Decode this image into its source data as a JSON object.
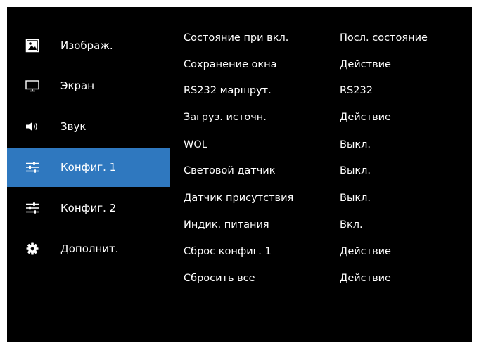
{
  "sidebar": {
    "items": [
      {
        "label": "Изображ.",
        "icon": "picture-icon",
        "active": false
      },
      {
        "label": "Экран",
        "icon": "monitor-icon",
        "active": false
      },
      {
        "label": "Звук",
        "icon": "speaker-icon",
        "active": false
      },
      {
        "label": "Конфиг. 1",
        "icon": "sliders-icon",
        "active": true
      },
      {
        "label": "Конфиг. 2",
        "icon": "sliders-icon",
        "active": false
      },
      {
        "label": "Дополнит.",
        "icon": "gear-icon",
        "active": false
      }
    ]
  },
  "settings": {
    "rows": [
      {
        "name": "Состояние при вкл.",
        "value": "Посл. состояние"
      },
      {
        "name": "Сохранение окна",
        "value": "Действие"
      },
      {
        "name": "RS232 маршрут.",
        "value": "RS232"
      },
      {
        "name": "Загруз. источн.",
        "value": "Действие"
      },
      {
        "name": "WOL",
        "value": "Выкл."
      },
      {
        "name": "Световой датчик",
        "value": "Выкл."
      },
      {
        "name": "Датчик присутствия",
        "value": "Выкл."
      },
      {
        "name": "Индик. питания",
        "value": "Вкл."
      },
      {
        "name": "Сброс конфиг. 1",
        "value": "Действие"
      },
      {
        "name": "Сбросить все",
        "value": "Действие"
      }
    ]
  },
  "colors": {
    "background": "#000000",
    "highlight": "#2f78bf",
    "text": "#ffffff"
  }
}
